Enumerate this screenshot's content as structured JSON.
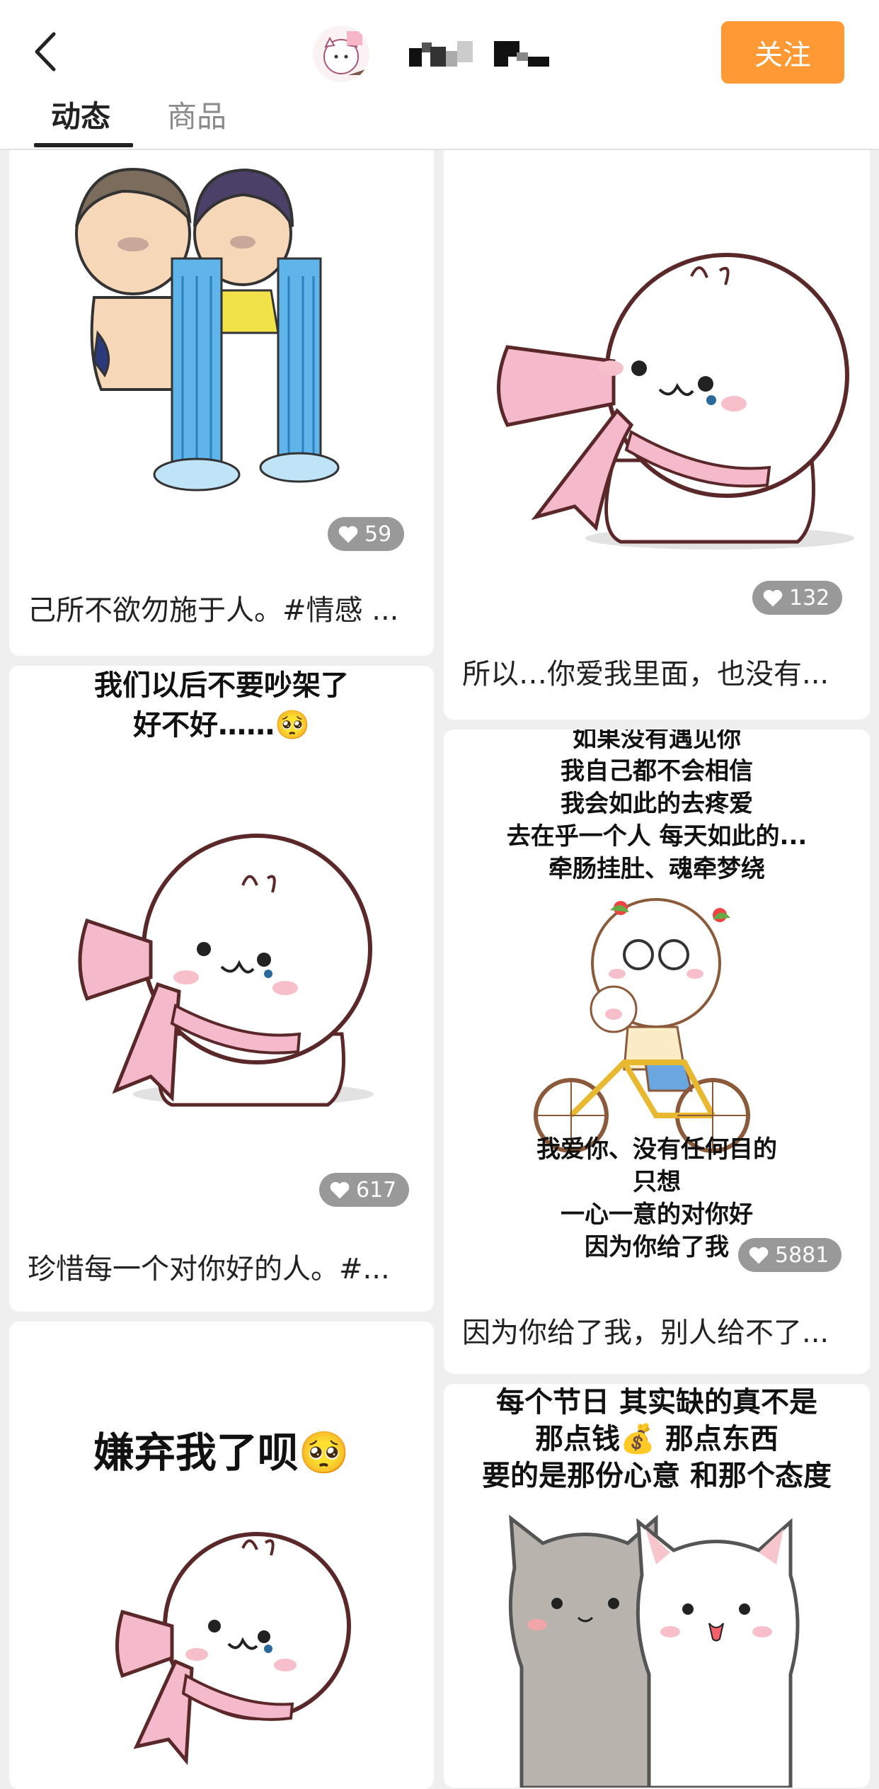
{
  "header": {
    "back_icon": "chevron-left-icon",
    "follow_label": "关注",
    "tabs": [
      {
        "label": "动态",
        "active": true
      },
      {
        "label": "商品",
        "active": false
      }
    ]
  },
  "feed": {
    "left": [
      {
        "caption": "己所不欲勿施于人。#情感 ...",
        "likes": "59"
      },
      {
        "overlay": [
          "我们以后不要吵架了",
          "好不好……🥺"
        ],
        "caption": "珍惜每一个对你好的人。#...",
        "likes": "617"
      },
      {
        "overlay": [
          "嫌弃我了呗🥺"
        ]
      }
    ],
    "right": [
      {
        "caption": "所以…你爱我里面，也没有...",
        "likes": "132"
      },
      {
        "overlay_top": [
          "如果没有遇见你",
          "我自己都不会相信",
          "我会如此的去疼爱",
          "去在乎一个人  每天如此的...",
          "牵肠挂肚、魂牵梦绕"
        ],
        "overlay_bottom": [
          "我爱你、没有任何目的",
          "只想",
          "一心一意的对你好",
          "因为你给了我"
        ],
        "caption": "因为你给了我，别人给不了...",
        "likes": "5881"
      },
      {
        "overlay": [
          "每个节日 其实缺的真不是",
          "那点钱💰 那点东西",
          "要的是那份心意 和那个态度"
        ]
      }
    ]
  },
  "colors": {
    "accent": "#ff9933",
    "like_badge": "#999999",
    "background": "#efefef"
  }
}
